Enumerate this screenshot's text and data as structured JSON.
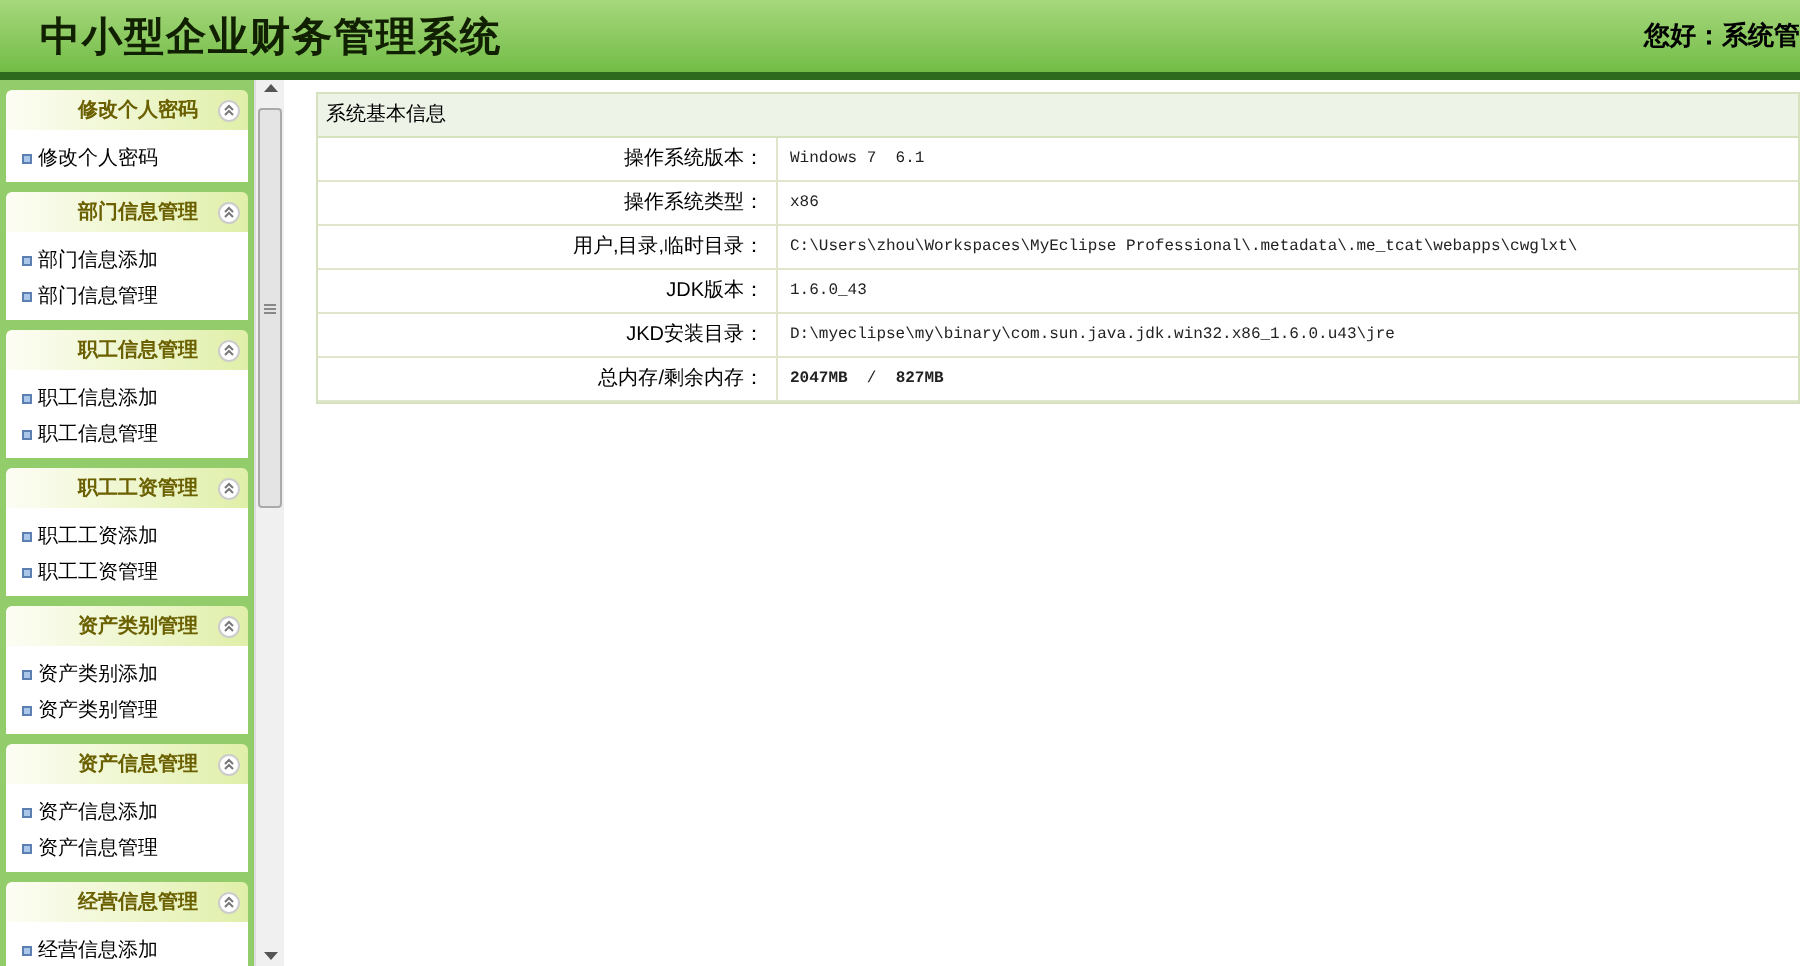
{
  "header": {
    "title": "中小型企业财务管理系统",
    "greeting": "您好：系统管"
  },
  "sidebar": {
    "groups": [
      {
        "title": "修改个人密码",
        "expanded": true,
        "items": [
          "修改个人密码"
        ]
      },
      {
        "title": "部门信息管理",
        "expanded": true,
        "items": [
          "部门信息添加",
          "部门信息管理"
        ]
      },
      {
        "title": "职工信息管理",
        "expanded": true,
        "items": [
          "职工信息添加",
          "职工信息管理"
        ]
      },
      {
        "title": "职工工资管理",
        "expanded": true,
        "items": [
          "职工工资添加",
          "职工工资管理"
        ]
      },
      {
        "title": "资产类别管理",
        "expanded": true,
        "items": [
          "资产类别添加",
          "资产类别管理"
        ]
      },
      {
        "title": "资产信息管理",
        "expanded": true,
        "items": [
          "资产信息添加",
          "资产信息管理"
        ]
      },
      {
        "title": "经营信息管理",
        "expanded": true,
        "items": [
          "经营信息添加"
        ]
      }
    ]
  },
  "panel": {
    "title": "系统基本信息",
    "rows": [
      {
        "label": "操作系统版本：",
        "value": "Windows 7  6.1"
      },
      {
        "label": "操作系统类型：",
        "value": "x86"
      },
      {
        "label": "用户,目录,临时目录：",
        "value": "C:\\Users\\zhou\\Workspaces\\MyEclipse Professional\\.metadata\\.me_tcat\\webapps\\cwglxt\\"
      },
      {
        "label": "JDK版本：",
        "value": "1.6.0_43"
      },
      {
        "label": "JKD安装目录：",
        "value": "D:\\myeclipse\\my\\binary\\com.sun.java.jdk.win32.x86_1.6.0.u43\\jre"
      },
      {
        "label": "总内存/剩余内存：",
        "value": "**2047MB**  /  **827MB**"
      }
    ]
  }
}
